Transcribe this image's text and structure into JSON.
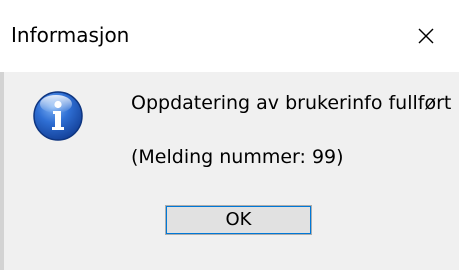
{
  "window": {
    "title": "Informasjon"
  },
  "dialog": {
    "icon": "information-icon",
    "message": "Oppdatering av brukerinfo fullført",
    "message_number": "(Melding nummer: 99)",
    "ok_label": "OK"
  },
  "colors": {
    "accent": "#0078d7",
    "icon_blue": "#1c5fc4"
  }
}
